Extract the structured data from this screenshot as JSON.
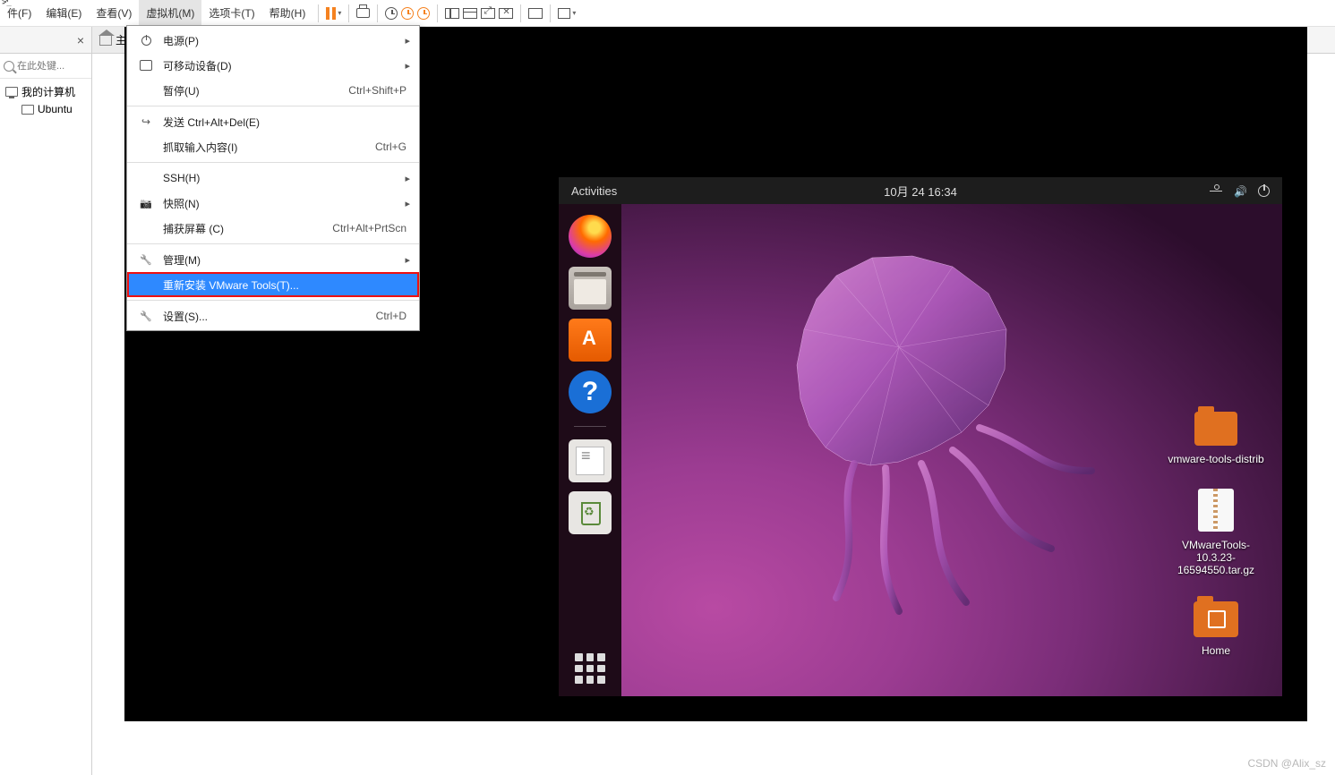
{
  "menubar": {
    "items": [
      "件(F)",
      "编辑(E)",
      "查看(V)",
      "虚拟机(M)",
      "选项卡(T)",
      "帮助(H)"
    ],
    "active_index": 3
  },
  "toolbar": {
    "pause": "暂停",
    "printer": "打印",
    "clock1": "时间",
    "clock2": "时间橙",
    "clock3": "时间橙",
    "layout_split_v": "左右分屏",
    "layout_split_h": "上下分屏",
    "layout_fit": "适应",
    "layout_x": "关闭布局",
    "terminal": "终端",
    "fullscreen": "全屏"
  },
  "tabs": {
    "close": "×",
    "home": "主"
  },
  "sidebar": {
    "search_placeholder": "在此处键...",
    "tree": [
      {
        "label": "我的计算机",
        "kind": "host"
      },
      {
        "label": "Ubuntu",
        "kind": "vm"
      }
    ]
  },
  "dropdown": {
    "items": [
      {
        "icon": "power",
        "label": "电源(P)",
        "shortcut": "",
        "arrow": true
      },
      {
        "icon": "usb",
        "label": "可移动设备(D)",
        "shortcut": "",
        "arrow": true
      },
      {
        "icon": "",
        "label": "暂停(U)",
        "shortcut": "Ctrl+Shift+P"
      },
      {
        "sep": true
      },
      {
        "icon": "send",
        "label": "发送 Ctrl+Alt+Del(E)",
        "shortcut": ""
      },
      {
        "icon": "",
        "label": "抓取输入内容(I)",
        "shortcut": "Ctrl+G"
      },
      {
        "sep": true
      },
      {
        "icon": "",
        "label": "SSH(H)",
        "shortcut": "",
        "arrow": true
      },
      {
        "icon": "camera",
        "label": "快照(N)",
        "shortcut": "",
        "arrow": true
      },
      {
        "icon": "",
        "label": "捕获屏幕 (C)",
        "shortcut": "Ctrl+Alt+PrtScn"
      },
      {
        "sep": true
      },
      {
        "icon": "wrench",
        "label": "管理(M)",
        "shortcut": "",
        "arrow": true
      },
      {
        "icon": "",
        "label": "重新安装 VMware Tools(T)...",
        "shortcut": "",
        "highlight": true,
        "red": true
      },
      {
        "sep": true
      },
      {
        "icon": "wrench",
        "label": "设置(S)...",
        "shortcut": "Ctrl+D"
      }
    ]
  },
  "guest": {
    "activities": "Activities",
    "clock": "10月 24  16:34",
    "desktop": [
      {
        "label": "vmware-tools-distrib",
        "kind": "folder"
      },
      {
        "label": "VMwareTools-10.3.23-16594550.tar.gz",
        "kind": "archive"
      },
      {
        "label": "Home",
        "kind": "home"
      }
    ]
  },
  "watermark": "CSDN @Alix_sz"
}
